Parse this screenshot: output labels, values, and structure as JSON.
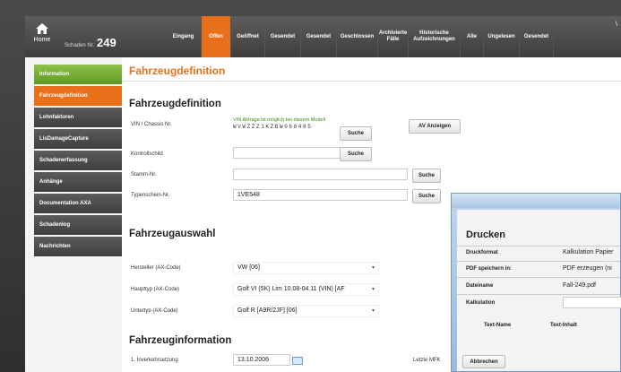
{
  "header": {
    "home_label": "Home",
    "case_label": "Schaden Nr.",
    "case_number": "249",
    "right_mark": "\\",
    "tabs": [
      {
        "label": "Eingang"
      },
      {
        "label": "Offen",
        "active": true
      },
      {
        "label": "Geöffnet"
      },
      {
        "label": "Gesendet"
      },
      {
        "label": "Gesendet"
      },
      {
        "label": "Geschlossen"
      },
      {
        "label": "Archivierte\nFälle"
      },
      {
        "label": "Historische\nAufzeichnungen"
      },
      {
        "label": "Alle"
      },
      {
        "label": "Ungelesen"
      },
      {
        "label": "Gesendet"
      }
    ]
  },
  "sidebar": {
    "items": [
      {
        "label": "Information"
      },
      {
        "label": "Fahrzeugdefinition"
      },
      {
        "label": "Lohnfaktoren"
      },
      {
        "label": "LisDamageCapture"
      },
      {
        "label": "Schadenerfassung"
      },
      {
        "label": "Anhänge"
      },
      {
        "label": "Documentation AXA"
      },
      {
        "label": "Schadenlog"
      },
      {
        "label": "Nachrichten"
      }
    ]
  },
  "main": {
    "page_title": "Fahrzeugdefinition",
    "section1": {
      "title": "Fahrzeugdefinition",
      "vin_label": "VIN / Chassis Nr.",
      "vin_hint": "VIN Abfrage ist möglich bei diesem Modell",
      "vin_value": "WVWZZZ1KZBW060485",
      "vin_search": "Suche",
      "av_button": "AV Anzeigen",
      "kontroll_label": "Kontrollschild",
      "kontroll_value": "",
      "kontroll_search": "Suche",
      "stamm_label": "Stamm-Nr.",
      "stamm_value": "",
      "stamm_search": "Suche",
      "typen_label": "Typenschein-Nr.",
      "typen_value": "1VE548",
      "typen_search": "Suche"
    },
    "section2": {
      "title": "Fahrzeugauswahl",
      "hersteller_label": "Hersteller (AX-Code)",
      "hersteller_value": "VW [06]",
      "haupttyp_label": "Haupttyp (AX-Code)",
      "haupttyp_value": "Golf VI (5K) Lim 10.08-04.11 (VIN) [AF",
      "untertyp_label": "Untertyp (AX-Code)",
      "untertyp_value": "Golf R [A9R/2JF] [06]"
    },
    "section3": {
      "title": "Fahrzeuginformation",
      "inverkehr_label": "1. Inverkehrsetzung",
      "inverkehr_value": "13.10.2006",
      "letzte_label": "Letzte MFK"
    }
  },
  "dialog": {
    "title": "Drucken",
    "druckformat_label": "Druckformat",
    "druckformat_value": "Kalkulation Papier",
    "pdf_label": "PDF speichern in:",
    "pdf_value": "PDF erzeugen (ni",
    "dateiname_label": "Dateiname",
    "dateiname_value": "Fall-249.pdf",
    "kalkulation_label": "Kalkulation",
    "col_name": "Text-Name",
    "col_inhalt": "Text-Inhalt",
    "cancel": "Abbrechen"
  }
}
